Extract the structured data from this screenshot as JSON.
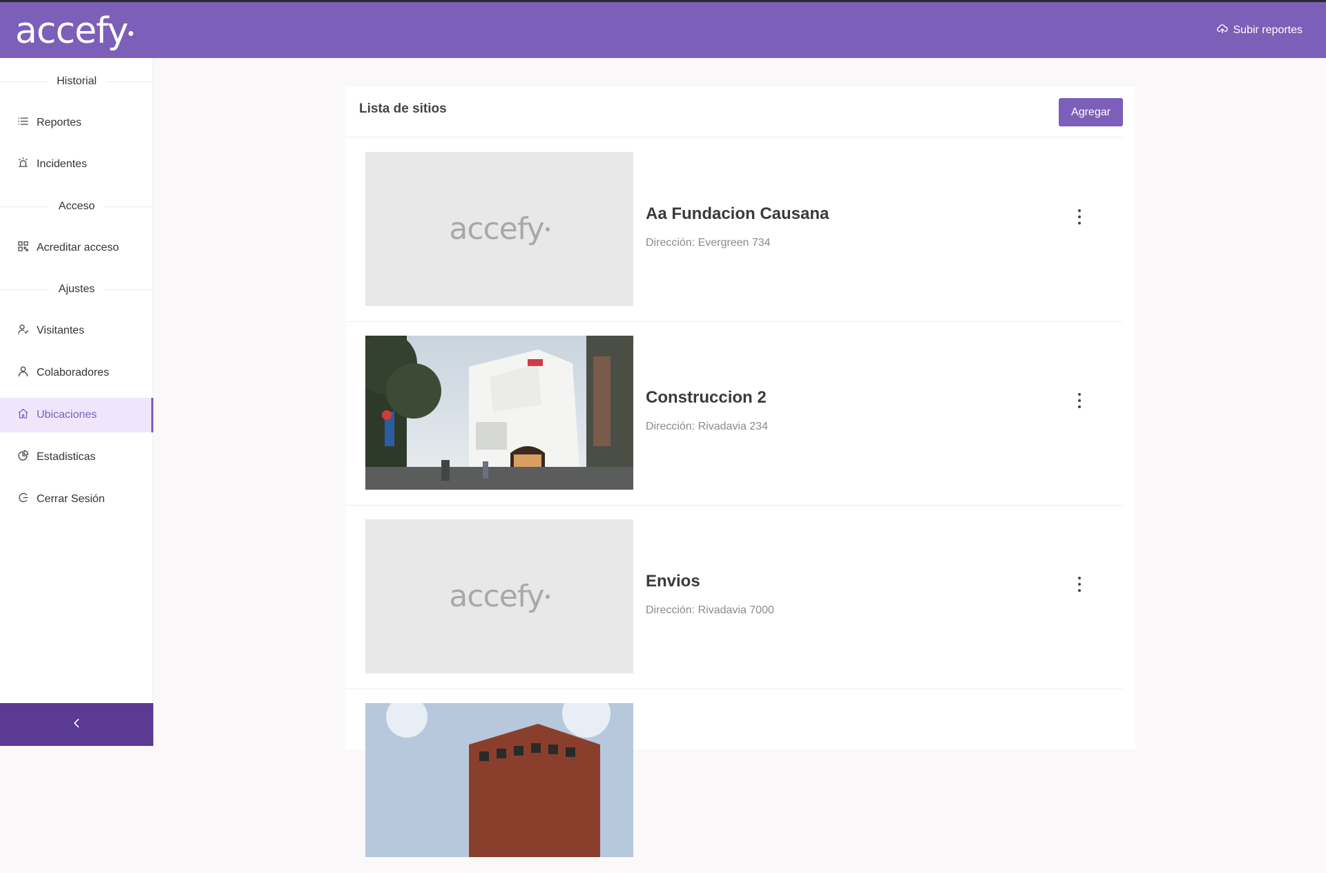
{
  "header": {
    "logo_text": "accefy",
    "upload_label": "Subir reportes",
    "upload_icon": "cloud-upload-icon",
    "bg_color": "#7c5fb8"
  },
  "sidebar": {
    "sections": [
      {
        "title": "Historial"
      },
      {
        "title": "Acceso"
      },
      {
        "title": "Ajustes"
      }
    ],
    "items": [
      {
        "label": "Reportes",
        "icon": "list-icon"
      },
      {
        "label": "Incidentes",
        "icon": "alarm-icon"
      },
      {
        "label": "Acreditar acceso",
        "icon": "qr-code-icon"
      },
      {
        "label": "Visitantes",
        "icon": "visitor-icon"
      },
      {
        "label": "Colaboradores",
        "icon": "user-icon"
      },
      {
        "label": "Ubicaciones",
        "icon": "home-icon",
        "active": true
      },
      {
        "label": "Estadisticas",
        "icon": "pie-chart-icon"
      },
      {
        "label": "Cerrar Sesión",
        "icon": "logout-icon"
      }
    ],
    "collapse_icon": "chevron-left-icon",
    "active_color": "#7c5fb8"
  },
  "main": {
    "title": "Lista de sitios",
    "add_label": "Agregar",
    "sites": [
      {
        "name": "Aa Fundacion Causana",
        "address": "Dirección: Evergreen 734",
        "image": "placeholder-logo"
      },
      {
        "name": "Construccion 2",
        "address": "Dirección: Rivadavia 234",
        "image": "building-photo"
      },
      {
        "name": "Envios",
        "address": "Dirección: Rivadavia 7000",
        "image": "placeholder-logo"
      },
      {
        "name": "",
        "address": "",
        "image": "building-photo"
      }
    ]
  }
}
